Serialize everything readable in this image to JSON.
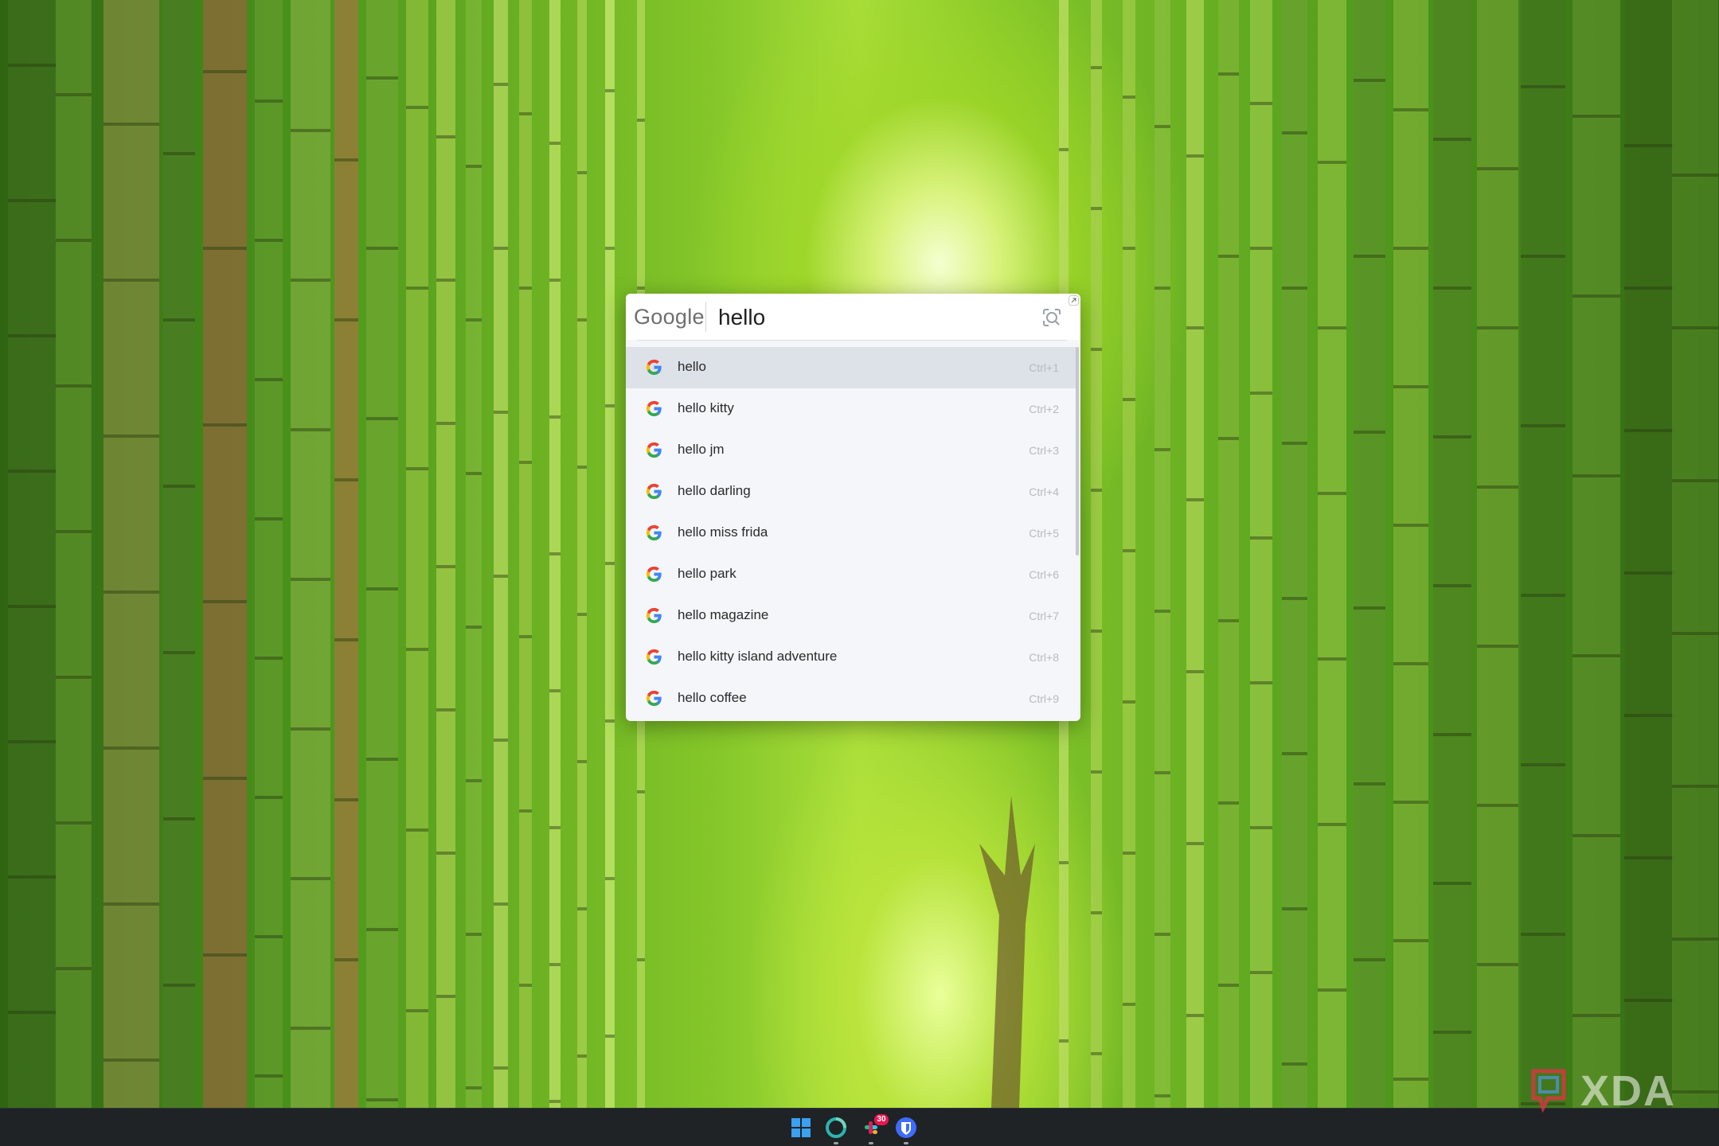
{
  "search": {
    "provider": "Google",
    "query": "hello",
    "suggestions": [
      {
        "text": "hello",
        "shortcut": "Ctrl+1",
        "selected": true
      },
      {
        "text": "hello kitty",
        "shortcut": "Ctrl+2"
      },
      {
        "text": "hello jm",
        "shortcut": "Ctrl+3"
      },
      {
        "text": "hello darling",
        "shortcut": "Ctrl+4"
      },
      {
        "text": "hello miss frida",
        "shortcut": "Ctrl+5"
      },
      {
        "text": "hello park",
        "shortcut": "Ctrl+6"
      },
      {
        "text": "hello magazine",
        "shortcut": "Ctrl+7"
      },
      {
        "text": "hello kitty island adventure",
        "shortcut": "Ctrl+8"
      },
      {
        "text": "hello coffee",
        "shortcut": "Ctrl+9"
      }
    ]
  },
  "taskbar": {
    "icons": [
      "windows-start-icon",
      "copilot-icon",
      "slack-icon",
      "bitwarden-icon"
    ],
    "notification_badge": "30"
  },
  "watermark": {
    "text": "XDA"
  },
  "colors": {
    "popup_background": "#f4f6f9",
    "selected_row": "#dde1e8",
    "taskbar": "#1f2326",
    "google_blue": "#4285F4",
    "google_red": "#EA4335",
    "google_yellow": "#FBBC05",
    "google_green": "#34A853"
  }
}
